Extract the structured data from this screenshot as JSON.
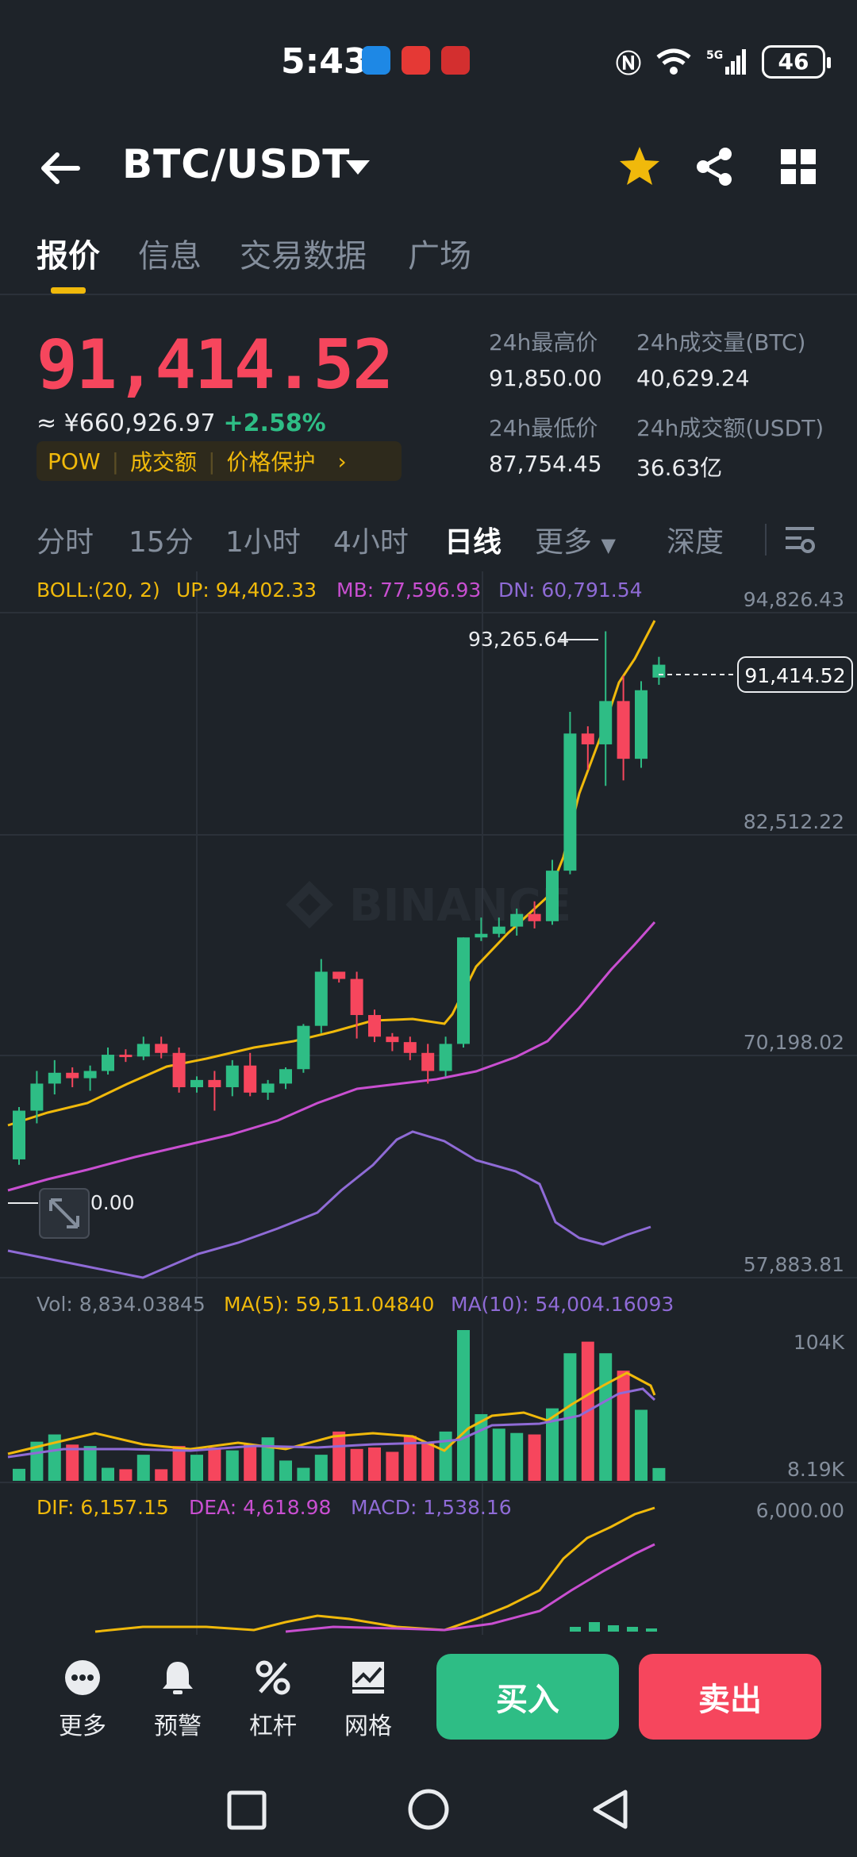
{
  "status": {
    "time": "5:43",
    "battery": "46",
    "network": "5G"
  },
  "header": {
    "pair": "BTC/USDT"
  },
  "tabs": [
    "报价",
    "信息",
    "交易数据",
    "广场"
  ],
  "price": {
    "last": "91,414.52",
    "fiat": "≈ ¥660,926.97",
    "change": "+2.58%",
    "tags": [
      "POW",
      "成交额",
      "价格保护"
    ]
  },
  "stats": {
    "high_label": "24h最高价",
    "high": "91,850.00",
    "vol_btc_label": "24h成交量(BTC)",
    "vol_btc": "40,629.24",
    "low_label": "24h最低价",
    "low": "87,754.45",
    "vol_usdt_label": "24h成交额(USDT)",
    "vol_usdt": "36.63亿"
  },
  "intervals": [
    "分时",
    "15分",
    "1小时",
    "4小时",
    "日线",
    "更多",
    "深度"
  ],
  "indicators": {
    "boll": "BOLL:(20, 2)",
    "up": "UP: 94,402.33",
    "mb": "MB: 77,596.93",
    "dn": "DN: 60,791.54",
    "vol": "Vol: 8,834.03845",
    "ma5": "MA(5): 59,511.04840",
    "ma10": "MA(10): 54,004.16093",
    "dif": "DIF: 6,157.15",
    "dea": "DEA: 4,618.98",
    "macd": "MACD: 1,538.16"
  },
  "axis": {
    "p1": "94,826.43",
    "p2": "82,512.22",
    "p3": "70,198.02",
    "p4": "57,883.81",
    "v_top": "104K",
    "v_bot": "8.19K",
    "m_top": "6,000.00",
    "hi_marker": "93,265.64",
    "lo_marker": "50.00",
    "last_tag": "91,414.52"
  },
  "watermark": "BINANCE",
  "bottom": {
    "more": "更多",
    "alert": "预警",
    "leverage": "杠杆",
    "grid": "网格",
    "buy": "买入",
    "sell": "卖出"
  },
  "colors": {
    "up": "#2ebd85",
    "down": "#f6465d",
    "accent": "#f0b90b",
    "bg": "#1e2329"
  },
  "chart_data": {
    "type": "candlestick",
    "candles": [
      [
        64000,
        66700,
        63700,
        66900
      ],
      [
        66700,
        68200,
        66000,
        68900
      ],
      [
        68200,
        68800,
        67600,
        69500
      ],
      [
        68800,
        68500,
        68000,
        69100
      ],
      [
        68500,
        68900,
        67800,
        69200
      ],
      [
        68900,
        69800,
        68700,
        70200
      ],
      [
        69800,
        69700,
        69400,
        70100
      ],
      [
        69700,
        70400,
        69500,
        70800
      ],
      [
        70400,
        69900,
        69600,
        70800
      ],
      [
        69900,
        68000,
        67700,
        70200
      ],
      [
        68000,
        68400,
        67700,
        68600
      ],
      [
        68400,
        68000,
        66700,
        68900
      ],
      [
        68000,
        69200,
        67500,
        69500
      ],
      [
        69200,
        67700,
        67500,
        69900
      ],
      [
        67700,
        68200,
        67300,
        68400
      ],
      [
        68200,
        69000,
        67900,
        69100
      ],
      [
        69000,
        71400,
        68800,
        71500
      ],
      [
        71400,
        74400,
        71000,
        75100
      ],
      [
        74400,
        74000,
        73800,
        74400
      ],
      [
        74000,
        72000,
        70700,
        74400
      ],
      [
        72000,
        70800,
        70500,
        72300
      ],
      [
        70800,
        70500,
        70000,
        71000
      ],
      [
        70500,
        69900,
        69500,
        70800
      ],
      [
        69900,
        68900,
        68200,
        70400
      ],
      [
        68900,
        70400,
        68600,
        70800
      ],
      [
        70400,
        76300,
        70200,
        76300
      ],
      [
        76300,
        76500,
        76100,
        77400
      ],
      [
        76500,
        76900,
        76300,
        77400
      ],
      [
        76900,
        77600,
        76400,
        77900
      ],
      [
        77600,
        77200,
        76800,
        78300
      ],
      [
        77200,
        80000,
        77000,
        80600
      ],
      [
        80000,
        87600,
        79800,
        88800
      ],
      [
        87600,
        87000,
        85600,
        88000
      ],
      [
        87000,
        89400,
        84700,
        93265.64
      ],
      [
        89400,
        86200,
        85000,
        90800
      ],
      [
        86200,
        90000,
        85700,
        90500
      ],
      [
        90700,
        91414.52,
        90300,
        91850
      ]
    ],
    "volume": [
      8300,
      27000,
      32000,
      25000,
      24000,
      9000,
      8000,
      18000,
      8000,
      24000,
      18000,
      23000,
      21000,
      25000,
      30000,
      14000,
      9000,
      18000,
      34000,
      22000,
      23000,
      20000,
      31000,
      26000,
      34000,
      104000,
      46000,
      36000,
      33000,
      32000,
      50000,
      88000,
      96000,
      88000,
      76000,
      49000,
      8834
    ],
    "ylim": [
      57883.81,
      94826.43
    ],
    "vlim": [
      8190,
      104000
    ]
  }
}
